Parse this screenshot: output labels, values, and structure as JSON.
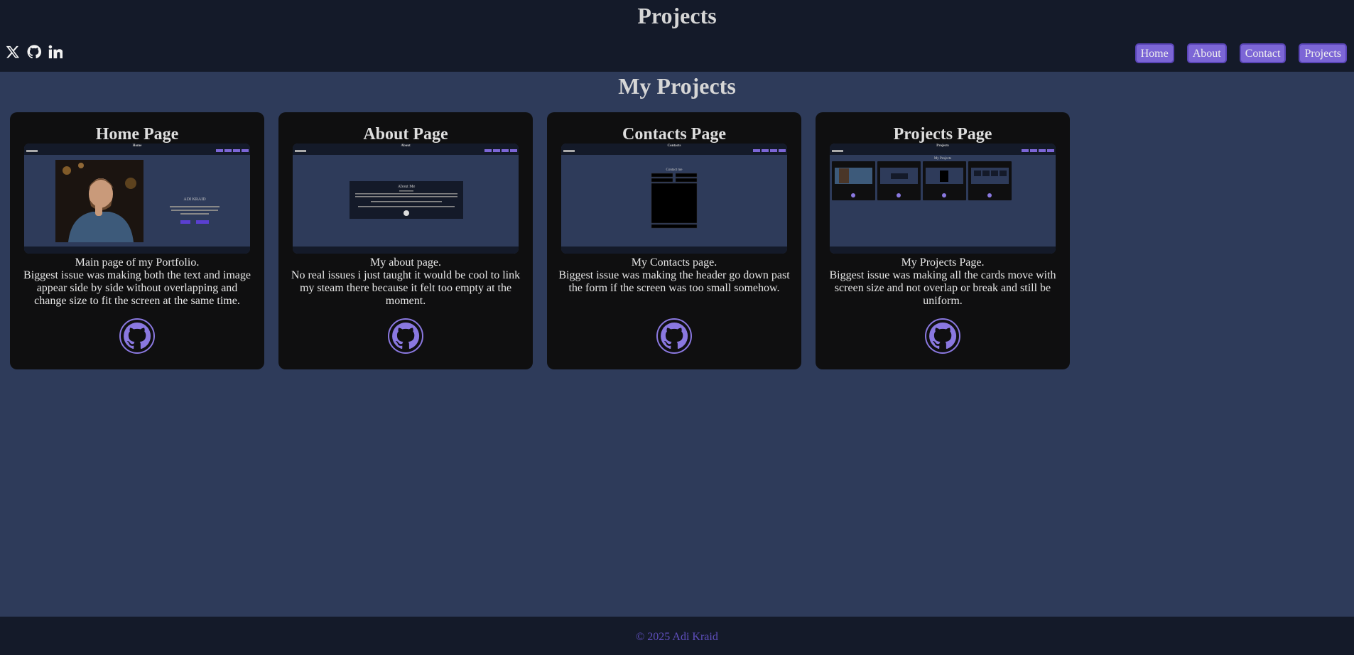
{
  "header": {
    "title": "Projects"
  },
  "socials": [
    {
      "icon": "x-icon"
    },
    {
      "icon": "github-icon"
    },
    {
      "icon": "linkedin-icon"
    }
  ],
  "nav": {
    "home": "Home",
    "about": "About",
    "contact": "Contact",
    "projects": "Projects"
  },
  "main": {
    "heading": "My Projects"
  },
  "cards": [
    {
      "title": "Home Page",
      "description": "Main page of my Portfolio.\nBiggest issue was making both the text and image appear side by side without overlapping and change size to fit the screen at the same time.",
      "shot_title": "Home",
      "shot_name": "ADI KRAID"
    },
    {
      "title": "About Page",
      "description": "My about page.\nNo real issues i just taught it would be cool to link my steam there because it felt too empty at the moment.",
      "shot_title": "About",
      "shot_heading": "About Me"
    },
    {
      "title": "Contacts Page",
      "description": "My Contacts page.\nBiggest issue was making the header go down past the form if the screen was too small somehow.",
      "shot_title": "Contacts",
      "shot_heading": "Contact me"
    },
    {
      "title": "Projects Page",
      "description": "My Projects Page.\nBiggest issue was making all the cards move with screen size and not overlap or break and still be uniform.",
      "shot_title": "Projects",
      "shot_heading": "My Projects"
    }
  ],
  "footer": {
    "text": "© 2025 Adi Kraid"
  },
  "colors": {
    "background": "#2e3b5a",
    "header": "#141a29",
    "card": "#0f0f10",
    "accent": "#7c66d6"
  }
}
